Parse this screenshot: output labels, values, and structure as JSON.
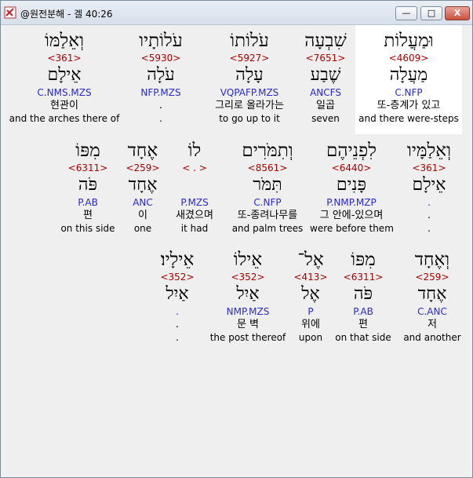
{
  "window": {
    "title": "@원전분해 - 겔 40:26"
  },
  "controls": {
    "minimize": "—",
    "maximize": "□",
    "close": "X"
  },
  "rows": [
    {
      "words": [
        {
          "heb": "וּמַעֲלוֹת",
          "num": "<4609>",
          "lemma": "מַעֲלָה",
          "parse": "C.NFP",
          "kor": "또-층계가 있고",
          "eng": "and there were-steps"
        },
        {
          "heb": "שִׁבְעָה",
          "num": "<7651>",
          "lemma": "שֶׁבַע",
          "parse": "ANCFS",
          "kor": "일곱",
          "eng": "seven"
        },
        {
          "heb": "עֹלוֹתוֹ",
          "num": "<5927>",
          "lemma": "עָלָה",
          "parse": "VQPAFP.MZS",
          "kor": "그리로 올라가는",
          "eng": "to go up to it"
        },
        {
          "heb": "עֹלוֹתָיו",
          "num": "<5930>",
          "lemma": "עֹלָה",
          "parse": "NFP.MZS",
          "kor": ".",
          "eng": "."
        },
        {
          "heb": "וְאֵלַמּוֹ",
          "num": "<361>",
          "lemma": "אֵילָם",
          "parse": "C.NMS.MZS",
          "kor": "현관이",
          "eng": "and the arches there of"
        }
      ]
    },
    {
      "words": [
        {
          "heb": "וְאֵלַמָּיו",
          "num": "<361>",
          "lemma": "אֵילָם",
          "parse": ".",
          "kor": ".",
          "eng": "."
        },
        {
          "heb": "לִפְנֵיהֶם",
          "num": "<6440>",
          "lemma": "פָּנִים",
          "parse": "P.NMP.MZP",
          "kor": "그 안에-있으며",
          "eng": "were before them"
        },
        {
          "heb": "וְתִמֹּרִים",
          "num": "<8561>",
          "lemma": "תִּמֹּר",
          "parse": "C.NFP",
          "kor": "또-종려나무를",
          "eng": "and palm trees"
        },
        {
          "heb": "לוֹ",
          "num": "< . >",
          "lemma": "",
          "parse": "P.MZS",
          "kor": "새겼으며",
          "eng": "it had"
        },
        {
          "heb": "אֶחָד",
          "num": "<259>",
          "lemma": "אֶחָד",
          "parse": "ANC",
          "kor": "이",
          "eng": "one"
        },
        {
          "heb": "מִפּוֹ",
          "num": "<6311>",
          "lemma": "פֹּה",
          "parse": "P.AB",
          "kor": "편",
          "eng": "on this side"
        }
      ]
    },
    {
      "words": [
        {
          "heb": "וְאֶחָד",
          "num": "<259>",
          "lemma": "אֶחָד",
          "parse": "C.ANC",
          "kor": "저",
          "eng": "and another"
        },
        {
          "heb": "מִפּוֹ",
          "num": "<6311>",
          "lemma": "פֹּה",
          "parse": "P.AB",
          "kor": "편",
          "eng": "on that side"
        },
        {
          "heb": "אֶל־",
          "num": "<413>",
          "lemma": "אֶל",
          "parse": "P",
          "kor": "위에",
          "eng": "upon"
        },
        {
          "heb": "אֵילוֹ",
          "num": "<352>",
          "lemma": "אַיִל",
          "parse": "NMP.MZS",
          "kor": "문 벽",
          "eng": "the post thereof"
        },
        {
          "heb": "אֵילָיו׃",
          "num": "<352>",
          "lemma": "אַיִל",
          "parse": ".",
          "kor": ".",
          "eng": "."
        }
      ]
    }
  ]
}
